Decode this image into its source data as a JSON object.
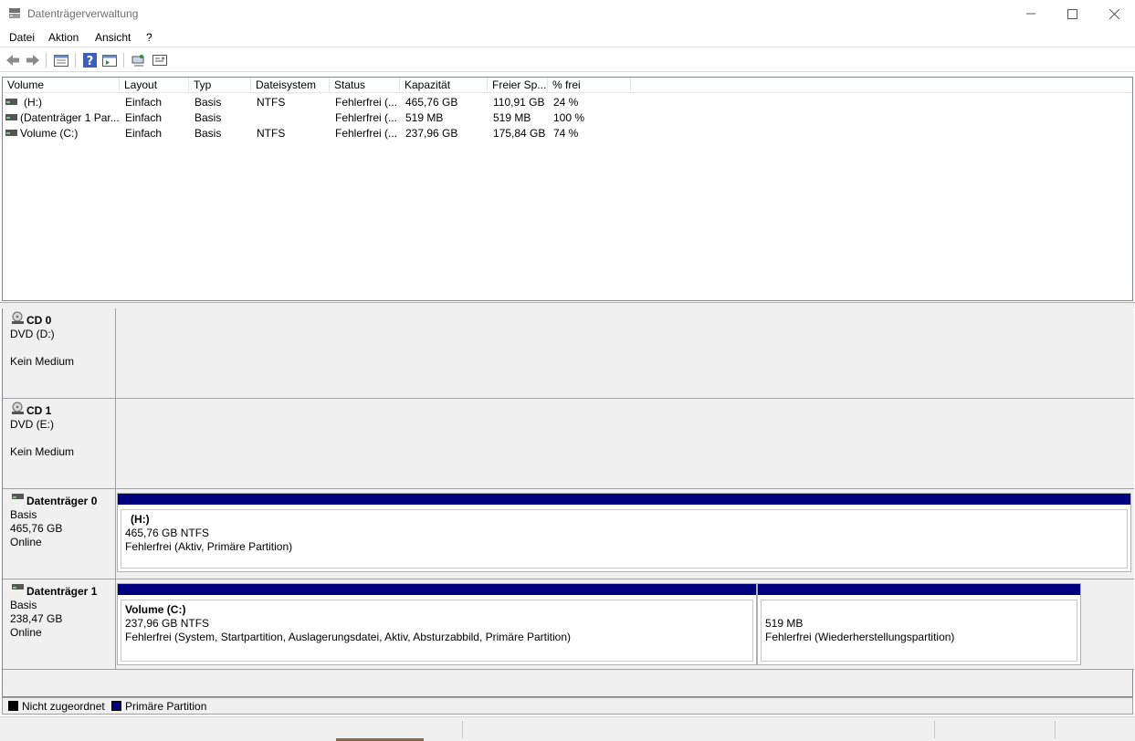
{
  "window": {
    "title": "Datenträgerverwaltung",
    "controls": [
      "minimize",
      "maximize",
      "close"
    ]
  },
  "menu": [
    "Datei",
    "Aktion",
    "Ansicht",
    "?"
  ],
  "toolbar": {
    "icons": [
      "back-icon",
      "forward-icon",
      "disk-list-icon",
      "help-icon",
      "console-icon",
      "connect-icon",
      "properties-icon"
    ]
  },
  "volume_list": {
    "columns": [
      "Volume",
      "Layout",
      "Typ",
      "Dateisystem",
      "Status",
      "Kapazität",
      "Freier Sp...",
      "% frei"
    ],
    "rows": [
      {
        "volume": "(H:)",
        "layout": "Einfach",
        "typ": "Basis",
        "fs": "NTFS",
        "status": "Fehlerfrei (...",
        "capacity": "465,76 GB",
        "free": "110,91 GB",
        "pct": "24 %"
      },
      {
        "volume": "(Datenträger 1 Par...",
        "layout": "Einfach",
        "typ": "Basis",
        "fs": "",
        "status": "Fehlerfrei (...",
        "capacity": "519 MB",
        "free": "519 MB",
        "pct": "100 %"
      },
      {
        "volume": "Volume (C:)",
        "layout": "Einfach",
        "typ": "Basis",
        "fs": "NTFS",
        "status": "Fehlerfrei (...",
        "capacity": "237,96 GB",
        "free": "175,84 GB",
        "pct": "74 %"
      }
    ]
  },
  "disks": [
    {
      "name": "CD 0",
      "line1": "DVD (D:)",
      "line2": "",
      "line3": "Kein Medium"
    },
    {
      "name": "CD 1",
      "line1": "DVD (E:)",
      "line2": "",
      "line3": "Kein Medium"
    },
    {
      "name": "Datenträger 0",
      "line1": "Basis",
      "line2": "465,76 GB",
      "line3": "Online",
      "partitions": [
        {
          "name": "(H:)",
          "size": "465,76 GB NTFS",
          "status": "Fehlerfrei (Aktiv, Primäre Partition)"
        }
      ]
    },
    {
      "name": "Datenträger 1",
      "line1": "Basis",
      "line2": "238,47 GB",
      "line3": "Online",
      "partitions": [
        {
          "name": "Volume  (C:)",
          "size": "237,96 GB NTFS",
          "status": "Fehlerfrei (System, Startpartition, Auslagerungsdatei, Aktiv, Absturzabbild, Primäre Partition)"
        },
        {
          "name": "",
          "size": "519 MB",
          "status": "Fehlerfrei (Wiederherstellungspartition)"
        }
      ]
    }
  ],
  "legend": [
    {
      "label": "Nicht zugeordnet",
      "color": "#000000"
    },
    {
      "label": "Primäre Partition",
      "color": "#00007f"
    }
  ]
}
